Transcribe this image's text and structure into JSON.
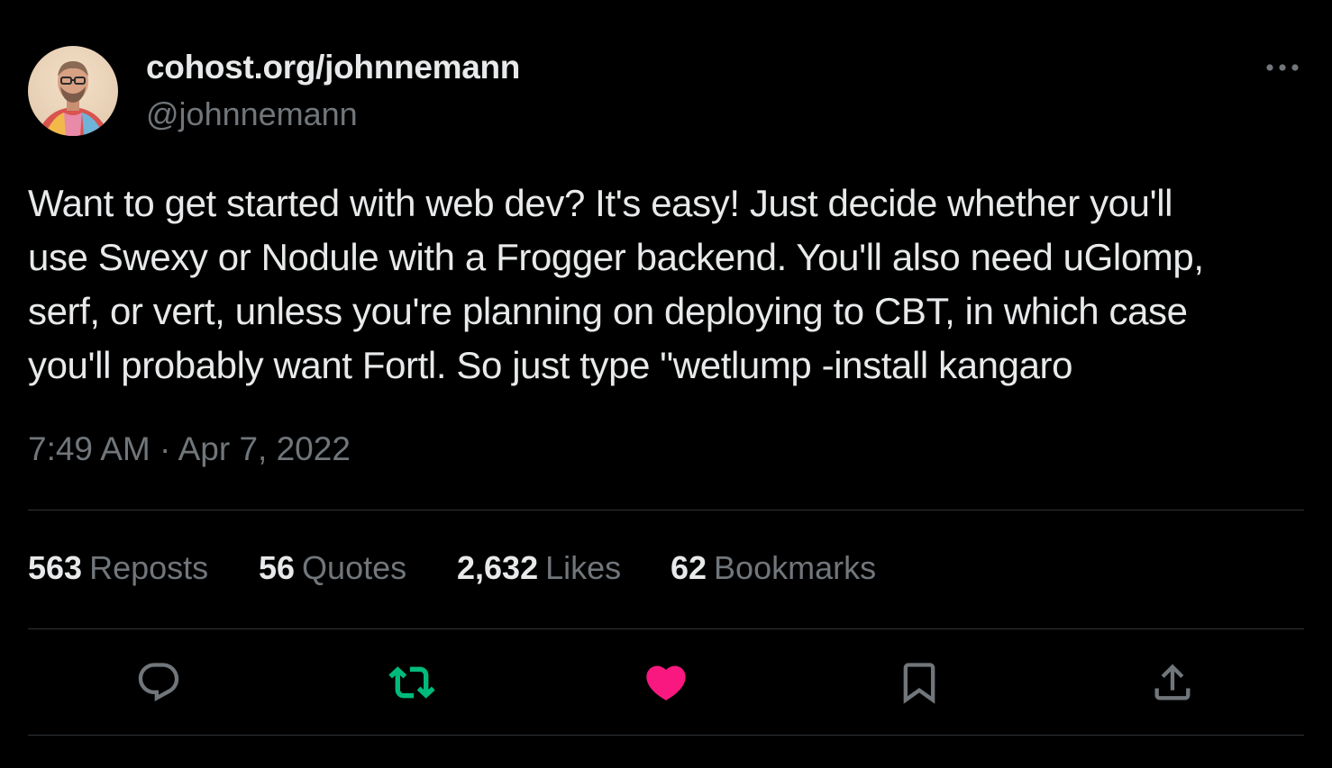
{
  "author": {
    "display_name": "cohost.org/johnnemann",
    "handle": "@johnnemann",
    "avatar_icon": "avatar-photo"
  },
  "tweet": {
    "text_lines": [
      "Want to get started with web dev? It's easy! Just decide whether you'll",
      "use Swexy or Nodule with a Frogger backend. You'll also need uGlomp,",
      "serf, or vert, unless you're planning on deploying to CBT, in which case",
      "you'll probably want Fortl. So just type \"wetlump -install kangaro"
    ],
    "timestamp": "7:49 AM · Apr 7, 2022"
  },
  "stats": {
    "reposts": {
      "count": "563",
      "label": "Reposts"
    },
    "quotes": {
      "count": "56",
      "label": "Quotes"
    },
    "likes": {
      "count": "2,632",
      "label": "Likes"
    },
    "bookmarks": {
      "count": "62",
      "label": "Bookmarks"
    }
  },
  "actions": [
    {
      "icon": "reply-icon",
      "color": "#71767b"
    },
    {
      "icon": "repost-icon",
      "color": "#00ba7c",
      "active": true
    },
    {
      "icon": "heart-icon",
      "color": "#f91880",
      "active": true
    },
    {
      "icon": "bookmark-icon",
      "color": "#71767b"
    },
    {
      "icon": "share-icon",
      "color": "#71767b"
    }
  ],
  "colors": {
    "background": "#000000",
    "text_primary": "#e7e9ea",
    "text_secondary": "#71767b",
    "divider": "#2f3336",
    "repost_active": "#00ba7c",
    "like_active": "#f91880"
  }
}
